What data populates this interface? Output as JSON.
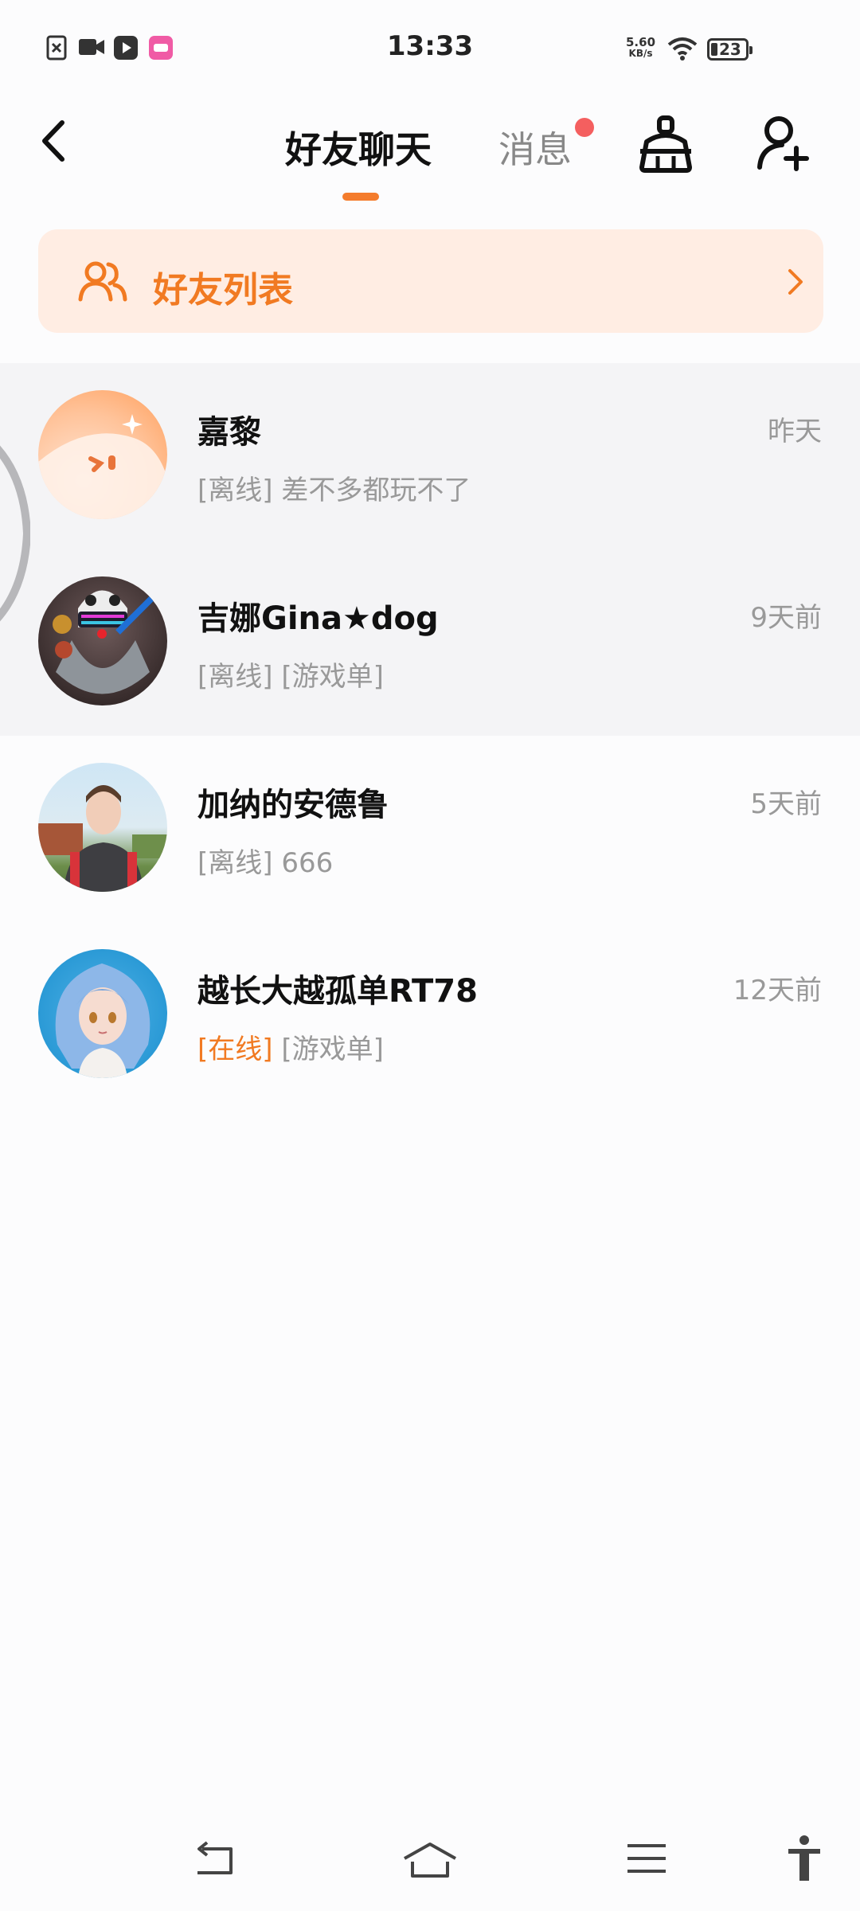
{
  "status_bar": {
    "time": "13:33",
    "net_speed_value": "5.60",
    "net_speed_unit": "KB/s",
    "battery": "23",
    "left_icons": [
      "sim-off-icon",
      "video-camera-icon",
      "play-icon",
      "app-notification-icon"
    ]
  },
  "header": {
    "tab_friends": "好友聊天",
    "tab_messages": "消息",
    "messages_has_badge": true
  },
  "banner": {
    "label": "好友列表"
  },
  "chats": [
    {
      "name": "嘉黎",
      "time": "昨天",
      "status": "[离线]",
      "message": "差不多都玩不了",
      "online": false
    },
    {
      "name": "吉娜Gina★dog",
      "time": "9天前",
      "status": "[离线]",
      "message": "[游戏单]",
      "online": false
    },
    {
      "name": "加纳的安德鲁",
      "time": "5天前",
      "status": "[离线]",
      "message": "666",
      "online": false
    },
    {
      "name": "越长大越孤单RT78",
      "time": "12天前",
      "status": "[在线]",
      "message": "[游戏单]",
      "online": true
    }
  ],
  "colors": {
    "accent": "#F17A22",
    "banner_bg": "#FFEDE3",
    "badge": "#F45F5F",
    "muted_text": "#999999"
  },
  "nav_bar": {
    "icons": [
      "nav-back-icon",
      "nav-home-icon",
      "nav-menu-icon",
      "accessibility-icon"
    ]
  }
}
